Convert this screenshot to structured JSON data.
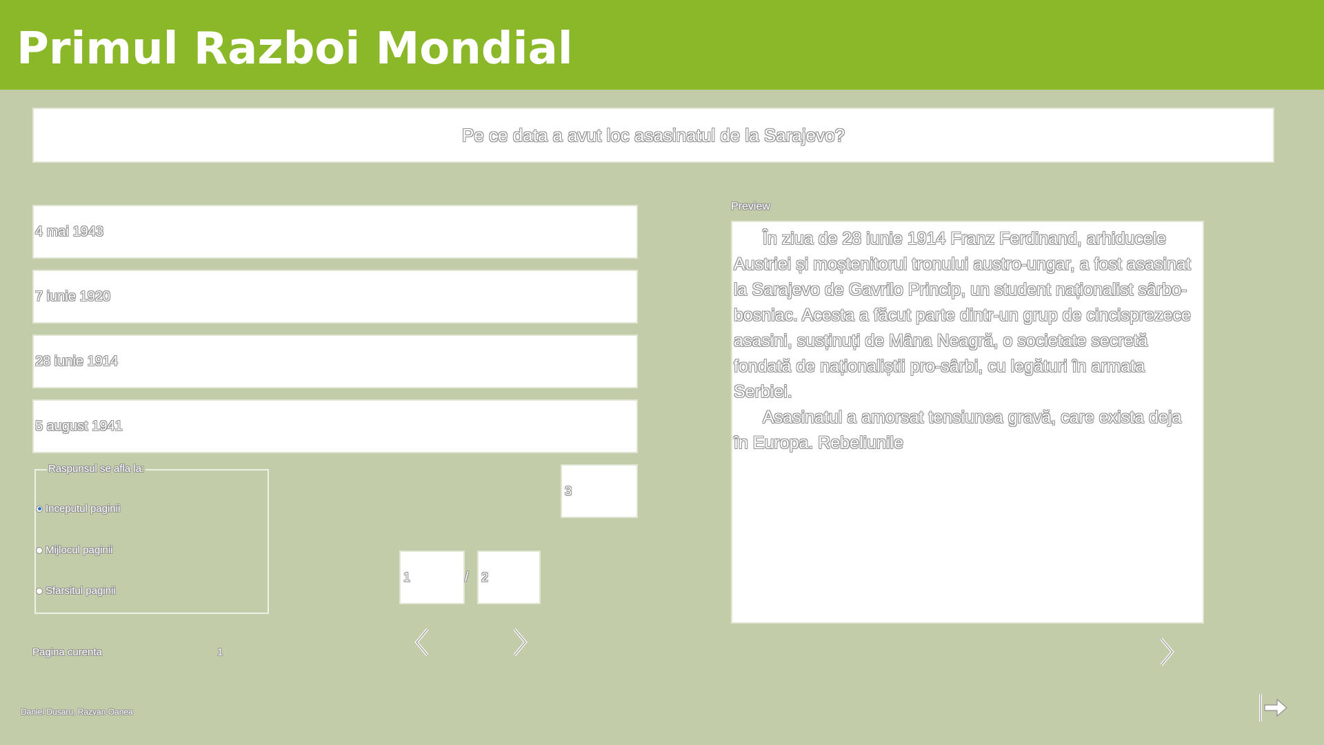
{
  "app": {
    "title": "Primul Razboi Mondial"
  },
  "question": {
    "text": "Pe ce data a avut loc asasinatul de la Sarajevo?"
  },
  "answers": [
    {
      "label": "4 mai 1943"
    },
    {
      "label": "7 iunie 1920"
    },
    {
      "label": "28 iunie 1914"
    },
    {
      "label": "5 august 1941"
    }
  ],
  "answer_number": {
    "value": "3"
  },
  "location_group": {
    "legend": "Raspunsul se afla la:",
    "options": [
      {
        "label": "Inceputul paginii",
        "checked": true
      },
      {
        "label": "Mijlocul paginii",
        "checked": false
      },
      {
        "label": "Sfarsitul paginii",
        "checked": false
      }
    ]
  },
  "pagination": {
    "current": "1",
    "separator": "/",
    "total": "2"
  },
  "current_page": {
    "label": "Pagina curenta",
    "value": "1"
  },
  "preview": {
    "label": "Preview",
    "paragraphs": [
      "În ziua de 28 iunie 1914 Franz Ferdinand, arhiducele Austriei și moștenitorul tronului austro-ungar, a fost asasinat la Sarajevo de Gavrilo Princip, un student naționalist sârbo-bosniac. Acesta a făcut parte dintr-un grup de cincisprezece asasini, susținuți de Mâna Neagră, o societate secretă fondată de naționaliștii pro-sârbi, cu legături în armata Serbiei.",
      "Asasinatul a amorsat tensiunea gravă, care exista deja în Europa. Rebeliunile"
    ]
  },
  "footer": {
    "authors": "Daniel Dusaru, Razvan Oanea"
  },
  "icons": {
    "prev": "chevron-left-icon",
    "next": "chevron-right-icon",
    "preview_next": "chevron-right-icon",
    "exit": "exit-icon"
  },
  "colors": {
    "header": "#8ab828",
    "background": "#c3cca8",
    "box": "#ffffff"
  }
}
